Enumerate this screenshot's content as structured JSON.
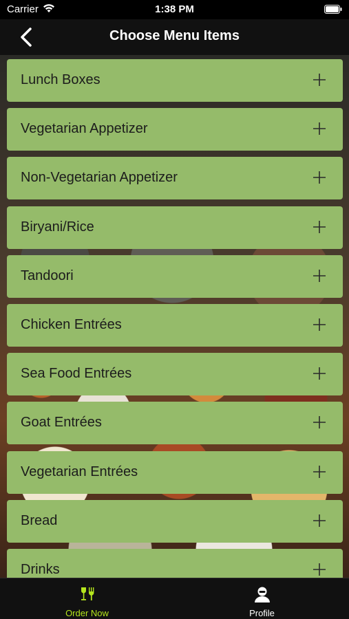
{
  "status_bar": {
    "carrier": "Carrier",
    "time": "1:38 PM"
  },
  "nav": {
    "title": "Choose Menu Items",
    "back_icon": "chevron-left-icon"
  },
  "menu": {
    "items": [
      {
        "label": "Lunch Boxes"
      },
      {
        "label": "Vegetarian Appetizer"
      },
      {
        "label": "Non-Vegetarian Appetizer"
      },
      {
        "label": "Biryani/Rice"
      },
      {
        "label": "Tandoori"
      },
      {
        "label": "Chicken Entrées"
      },
      {
        "label": "Sea Food Entrées"
      },
      {
        "label": "Goat Entrées"
      },
      {
        "label": "Vegetarian Entrées"
      },
      {
        "label": "Bread"
      },
      {
        "label": "Drinks"
      }
    ],
    "expand_icon": "plus-icon",
    "item_color": "#95bb6a"
  },
  "tabs": [
    {
      "label": "Order Now",
      "icon": "fork-knife-icon",
      "active": true,
      "color": "#b5e61d"
    },
    {
      "label": "Profile",
      "icon": "person-icon",
      "active": false,
      "color": "#ffffff"
    }
  ]
}
